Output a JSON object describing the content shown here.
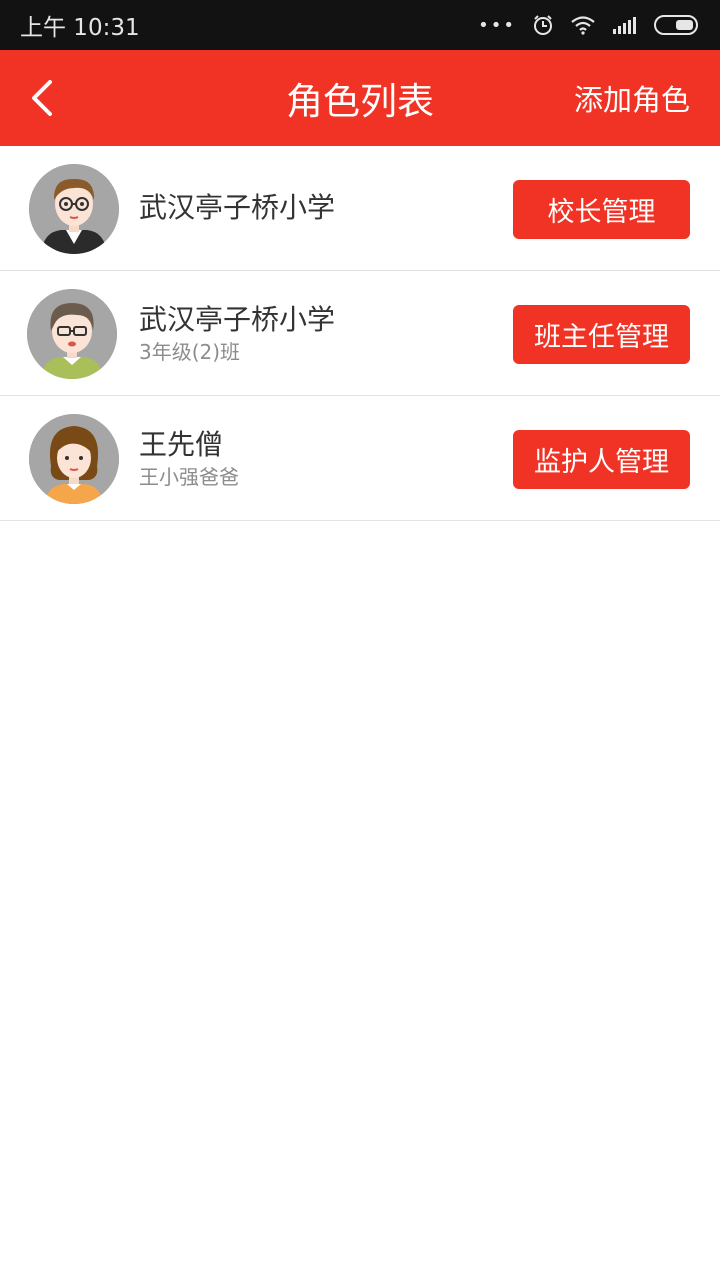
{
  "statusbar": {
    "time": "上午 10:31",
    "icons": [
      "more-dots-icon",
      "alarm-icon",
      "wifi-icon",
      "signal-icon",
      "battery-icon"
    ]
  },
  "header": {
    "title": "角色列表",
    "action": "添加角色",
    "back_icon": "chevron-left-icon"
  },
  "roles": [
    {
      "name": "武汉亭子桥小学",
      "sub": "",
      "button": "校长管理",
      "avatar": "principal-avatar"
    },
    {
      "name": "武汉亭子桥小学",
      "sub": "3年级(2)班",
      "button": "班主任管理",
      "avatar": "teacher-avatar"
    },
    {
      "name": "王先僧",
      "sub": "王小强爸爸",
      "button": "监护人管理",
      "avatar": "guardian-avatar"
    }
  ],
  "colors": {
    "accent": "#f03324",
    "statusbar": "#121212",
    "divider": "#e3e3e3"
  }
}
